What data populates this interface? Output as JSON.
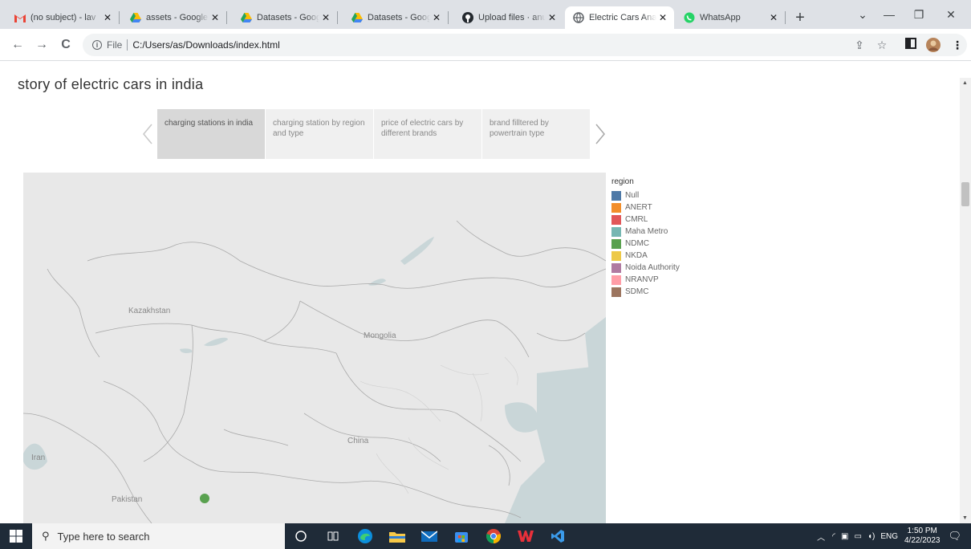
{
  "browser": {
    "tabs": [
      {
        "title": "(no subject) - lav",
        "icon": "gmail-icon",
        "color": "#ea4335"
      },
      {
        "title": "assets - Google D",
        "icon": "google-drive-icon",
        "color": "#fbbc04"
      },
      {
        "title": "Datasets - Google",
        "icon": "google-drive-icon",
        "color": "#fbbc04"
      },
      {
        "title": "Datasets - Google",
        "icon": "google-drive-icon",
        "color": "#fbbc04"
      },
      {
        "title": "Upload files · anu",
        "icon": "github-icon",
        "color": "#24292f"
      },
      {
        "title": "Electric Cars Anal",
        "icon": "globe-icon",
        "color": "#5f6368",
        "active": true
      },
      {
        "title": "WhatsApp",
        "icon": "whatsapp-icon",
        "color": "#25d366"
      }
    ],
    "new_tab": "+",
    "address": {
      "scheme_label": "File",
      "url": "C:/Users/as/Downloads/index.html"
    }
  },
  "page": {
    "story_title": "story of electric cars in india",
    "story_points": [
      {
        "label": "charging stations in india",
        "active": true
      },
      {
        "label": "charging station by region and type",
        "active": false
      },
      {
        "label": "price of electric cars by different brands",
        "active": false
      },
      {
        "label": "brand filltered by powertrain type",
        "active": false
      }
    ],
    "map": {
      "labels": [
        "Kazakhstan",
        "Mongolia",
        "China",
        "Iran",
        "Pakistan"
      ],
      "marker_color": "#59a14f"
    },
    "legend": {
      "title": "region",
      "items": [
        {
          "label": "Null",
          "color": "#4e79a7"
        },
        {
          "label": "ANERT",
          "color": "#f28e2b"
        },
        {
          "label": "CMRL",
          "color": "#e15759"
        },
        {
          "label": "Maha Metro",
          "color": "#76b7b2"
        },
        {
          "label": "NDMC",
          "color": "#59a14f"
        },
        {
          "label": "NKDA",
          "color": "#edc948"
        },
        {
          "label": "Noida Authority",
          "color": "#b07aa1"
        },
        {
          "label": "NRANVP",
          "color": "#ff9da7"
        },
        {
          "label": "SDMC",
          "color": "#9c755f"
        }
      ]
    }
  },
  "taskbar": {
    "search_placeholder": "Type here to search",
    "language": "ENG",
    "time": "1:50 PM",
    "date": "4/22/2023"
  }
}
